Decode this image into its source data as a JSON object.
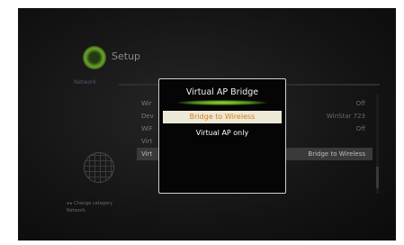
{
  "setup": {
    "title": "Setup",
    "category": "Network"
  },
  "rows": [
    {
      "label": "Wir",
      "value": "Off"
    },
    {
      "label": "Dev",
      "value": "WinStar 723"
    },
    {
      "label": "WiF",
      "value": "Off"
    },
    {
      "label": "Virt",
      "value": ""
    },
    {
      "label": "Virt",
      "value": "Bridge to Wireless",
      "selected": true
    }
  ],
  "hint": {
    "line1": "Change category",
    "line2": "Network"
  },
  "dialog": {
    "title": "Virtual AP Bridge",
    "options": [
      "Bridge to Wireless",
      "Virtual AP only"
    ],
    "selected": "Bridge to Wireless"
  },
  "colors": {
    "accent": "#e07a10",
    "highlight": "#ece9d6",
    "glow": "#8cd236"
  }
}
